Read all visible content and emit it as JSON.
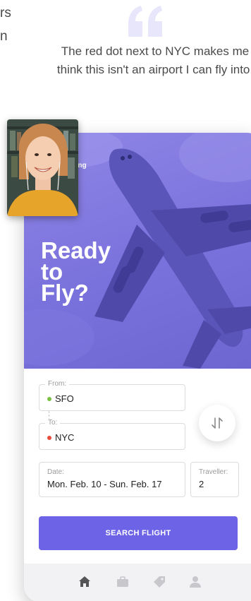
{
  "left_crop": {
    "line1": "rs",
    "line2": "n"
  },
  "quote": {
    "mark_color": "#e8e6fb",
    "text": "The red dot next to NYC makes me think this isn't an airport I can fly into."
  },
  "app": {
    "brand_partial": "king",
    "hero_title": [
      "Ready",
      "to",
      "Fly?"
    ],
    "from": {
      "legend": "From:",
      "value": "SFO",
      "dot_color": "#7ac143"
    },
    "to": {
      "legend": "To:",
      "value": "NYC",
      "dot_color": "#e74c3c"
    },
    "date": {
      "label": "Date:",
      "value": "Mon. Feb. 10 - Sun. Feb. 17"
    },
    "traveller": {
      "label": "Traveller:",
      "value": "2"
    },
    "search_label": "SEARCH FLIGHT",
    "colors": {
      "accent": "#6c63e6",
      "hero": "#7a72dc",
      "tab_active": "#555555",
      "tab_inactive": "#c8c8cc"
    },
    "tabs": [
      {
        "name": "home",
        "icon": "home-icon",
        "active": true
      },
      {
        "name": "trips",
        "icon": "briefcase-icon",
        "active": false
      },
      {
        "name": "deals",
        "icon": "tag-icon",
        "active": false
      },
      {
        "name": "profile",
        "icon": "user-icon",
        "active": false
      }
    ]
  },
  "webcam": {
    "icon": "user-webcam-feed"
  }
}
